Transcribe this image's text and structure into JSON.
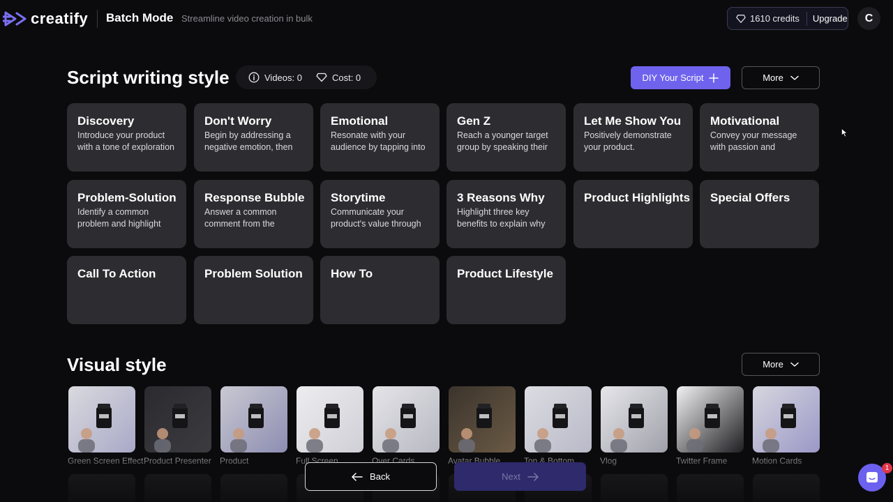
{
  "header": {
    "brand": "creatify",
    "title": "Batch Mode",
    "subtitle": "Streamline video creation in bulk",
    "credits_label": "1610 credits",
    "upgrade_label": "Upgrade",
    "avatar_initial": "C"
  },
  "script_section": {
    "title": "Script writing style",
    "videos_label": "Videos: 0",
    "cost_label": "Cost: 0",
    "diy_label": "DIY Your Script",
    "more_label": "More",
    "cards": [
      {
        "title": "Discovery",
        "desc": "Introduce your product with a tone of exploration"
      },
      {
        "title": "Don't Worry",
        "desc": "Begin by addressing a negative emotion, then"
      },
      {
        "title": "Emotional",
        "desc": "Resonate with your audience by tapping into"
      },
      {
        "title": "Gen Z",
        "desc": "Reach a younger target group by speaking their"
      },
      {
        "title": "Let Me Show You",
        "desc": "Positively demonstrate your product."
      },
      {
        "title": "Motivational",
        "desc": "Convey your message with passion and"
      },
      {
        "title": "Problem-Solution",
        "desc": "Identify a common problem and highlight"
      },
      {
        "title": "Response Bubble",
        "desc": "Answer a common comment from the"
      },
      {
        "title": "Storytime",
        "desc": "Communicate your product's value through"
      },
      {
        "title": "3 Reasons Why",
        "desc": "Highlight three key benefits to explain why"
      },
      {
        "title": "Product Highlights",
        "desc": ""
      },
      {
        "title": "Special Offers",
        "desc": ""
      },
      {
        "title": "Call To Action",
        "desc": ""
      },
      {
        "title": "Problem Solution",
        "desc": ""
      },
      {
        "title": "How To",
        "desc": ""
      },
      {
        "title": "Product Lifestyle",
        "desc": ""
      }
    ]
  },
  "visual_section": {
    "title": "Visual style",
    "more_label": "More",
    "items": [
      {
        "label": "Green Screen Effect"
      },
      {
        "label": "Product Presenter"
      },
      {
        "label": "Product"
      },
      {
        "label": "Full Screen"
      },
      {
        "label": "Over Cards"
      },
      {
        "label": "Avatar Bubble"
      },
      {
        "label": "Top & Bottom"
      },
      {
        "label": "Vlog"
      },
      {
        "label": "Twitter Frame"
      },
      {
        "label": "Motion Cards"
      }
    ]
  },
  "footer": {
    "back_label": "Back",
    "next_label": "Next",
    "chat_badge": "1"
  },
  "colors": {
    "accent": "#6f63ee",
    "card_bg": "#2d2d31",
    "page_bg": "#0b0b0d"
  }
}
